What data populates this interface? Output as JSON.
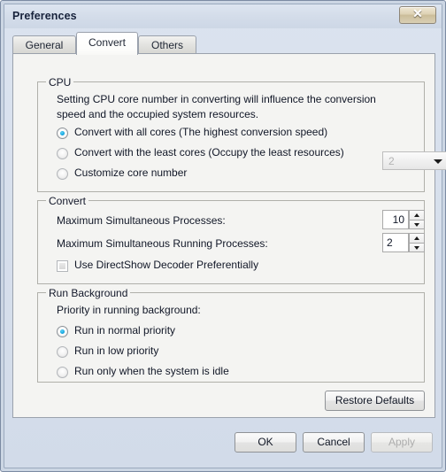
{
  "window": {
    "title": "Preferences",
    "close_label": "✕",
    "close_icon": "close-x-icon"
  },
  "tabs": [
    {
      "id": "general",
      "label": "General",
      "active": false
    },
    {
      "id": "convert",
      "label": "Convert",
      "active": true
    },
    {
      "id": "others",
      "label": "Others",
      "active": false
    }
  ],
  "cpu": {
    "group_title": "CPU",
    "description": "Setting CPU core number in converting will influence the conversion speed and the occupied system resources.",
    "options": [
      {
        "label": "Convert with all cores (The highest conversion speed)",
        "checked": true
      },
      {
        "label": "Convert with the least cores (Occupy the least resources)",
        "checked": false
      },
      {
        "label": "Customize core number",
        "checked": false
      }
    ],
    "core_combo": {
      "value": "2",
      "enabled": false,
      "arrow_icon": "chevron-down-icon"
    }
  },
  "convert": {
    "group_title": "Convert",
    "max_simultaneous_processes_label": "Maximum Simultaneous Processes:",
    "max_simultaneous_processes_value": "10",
    "max_running_processes_label": "Maximum Simultaneous Running Processes:",
    "max_running_processes_value": "2",
    "directshow_label": "Use DirectShow Decoder Preferentially",
    "directshow_checked": false
  },
  "run_background": {
    "group_title": "Run Background",
    "priority_label": "Priority in running background:",
    "options": [
      {
        "label": "Run in normal priority",
        "checked": true
      },
      {
        "label": "Run in low priority",
        "checked": false
      },
      {
        "label": "Run only when the system is idle",
        "checked": false
      }
    ]
  },
  "buttons": {
    "restore_defaults": "Restore Defaults",
    "ok": "OK",
    "cancel": "Cancel",
    "apply": "Apply",
    "apply_enabled": false
  },
  "colors": {
    "accent_radio": "#13a6e0",
    "titlebar": "#d3dce9",
    "panel": "#f4f4f2",
    "frame": "#ccd6e4"
  }
}
